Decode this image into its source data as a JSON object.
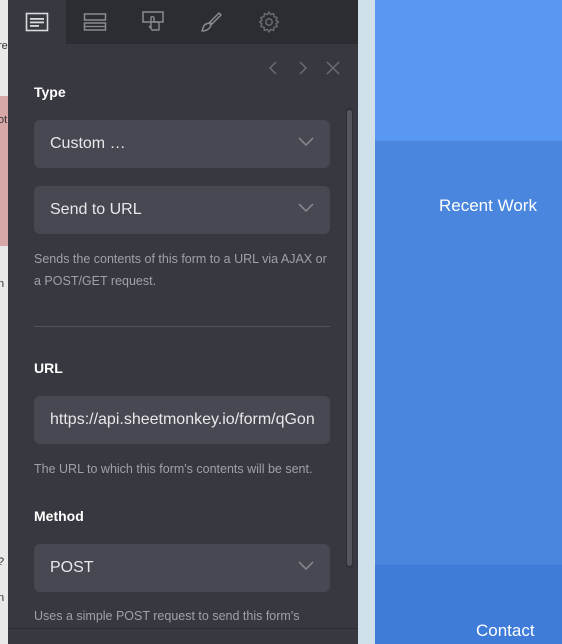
{
  "underlying_page": {
    "fragments": [
      "re",
      "ot",
      "n",
      "?",
      "n"
    ]
  },
  "tabs": [
    {
      "icon": "form-settings-icon",
      "active": true
    },
    {
      "icon": "layout-icon",
      "active": false
    },
    {
      "icon": "interaction-icon",
      "active": false
    },
    {
      "icon": "style-brush-icon",
      "active": false
    },
    {
      "icon": "gear-icon",
      "active": false
    }
  ],
  "nav": {
    "prev_icon": "chevron-left-icon",
    "next_icon": "chevron-right-icon",
    "close_icon": "close-icon"
  },
  "type": {
    "label": "Type",
    "select1": "Custom …",
    "select2": "Send to URL",
    "help": "Sends the contents of this form to a URL via AJAX or a POST/GET request."
  },
  "url": {
    "label": "URL",
    "value": "https://api.sheetmonkey.io/form/qGon",
    "help": "The URL to which this form's contents will be sent."
  },
  "method": {
    "label": "Method",
    "select": "POST",
    "help": "Uses a simple POST request to send this form's"
  },
  "preview": {
    "recent_work": "Recent Work",
    "contact": "Contact"
  },
  "colors": {
    "panel": "#383940",
    "tabbar": "#2c2d33",
    "field": "#474851",
    "accent_blue": "#4b87e0"
  }
}
